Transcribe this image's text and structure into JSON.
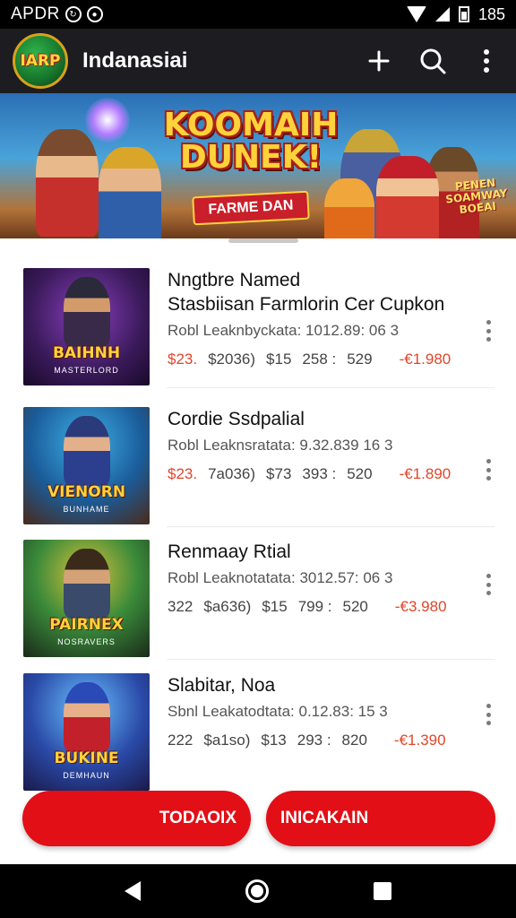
{
  "status_bar": {
    "carrier": "APDR",
    "time": "185"
  },
  "app_bar": {
    "logo_text": "IARP",
    "title": "Indanasiai",
    "add_icon": "+",
    "search_icon": "search-icon",
    "more_icon": "more-vert-icon"
  },
  "banner": {
    "title": "KOOMAIH DUNEK!",
    "subtitle": "FARME DAN",
    "side_text": "PENEN SOAMWAY BOEAI"
  },
  "games": [
    {
      "title": "Nngtbre Named",
      "subtitle": "Stasbiisan Farmlorin Cer Cupkon",
      "meta": "Robl Leaknbyckata: 1012.89: 06 3",
      "thumb_text": "BAIHNH",
      "thumb_sub": "MASTERLORD",
      "price_1": "$23.",
      "price_2": "$2036)",
      "price_3": "$15",
      "price_4": "258 :",
      "price_5": "529",
      "price_old": "-€1.980"
    },
    {
      "title": "Cordie Ssdpalial",
      "subtitle": "",
      "meta": "Robl Leaknsratata: 9.32.839 16 3",
      "thumb_text": "VIENORN",
      "thumb_sub": "BUNHAME",
      "price_1": "$23.",
      "price_2": "7a036)",
      "price_3": "$73",
      "price_4": "393 :",
      "price_5": "520",
      "price_old": "-€1.890"
    },
    {
      "title": "Renmaay Rtial",
      "subtitle": "",
      "meta": "Robl Leaknotatata: 3012.57: 06 3",
      "thumb_text": "PAIRNEX",
      "thumb_sub": "NOSRAVERS",
      "price_1": "322",
      "price_2": "$a636)",
      "price_3": "$15",
      "price_4": "799 :",
      "price_5": "520",
      "price_old": "-€3.980"
    },
    {
      "title": "Slabitar, Noa",
      "subtitle": "",
      "meta": "Sbnl Leakatodtata: 0.12.83: 15 3",
      "thumb_text": "BUKINE",
      "thumb_sub": "DEMHAUN",
      "price_1": "222",
      "price_2": "$a1so)",
      "price_3": "$13",
      "price_4": "293 :",
      "price_5": "820",
      "price_old": "-€1.390"
    }
  ],
  "actions": {
    "left_label": "TODAOIX",
    "right_label": "INICAKAIN"
  },
  "colors": {
    "accent_red": "#e30f16",
    "price_red": "#e0462a",
    "app_bar": "#1c1c21"
  }
}
